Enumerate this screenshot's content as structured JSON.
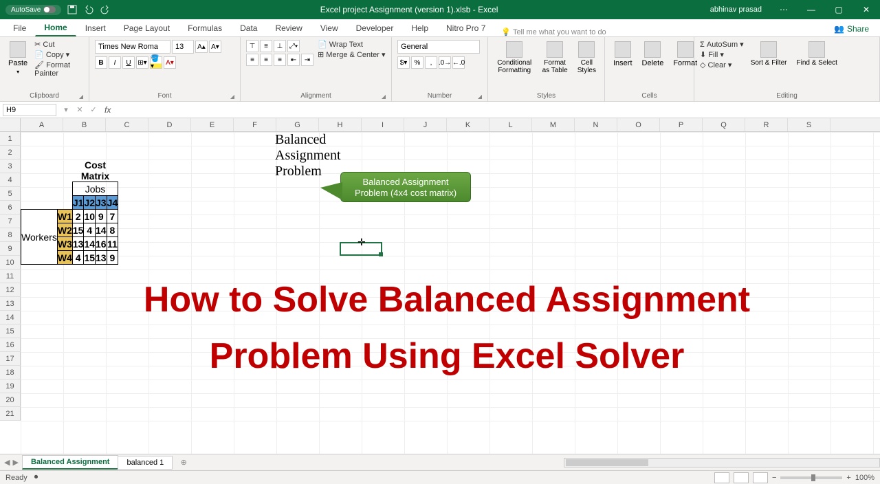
{
  "titlebar": {
    "autosave": "AutoSave",
    "title": "Excel project Assignment (version 1).xlsb - Excel",
    "user": "abhinav prasad"
  },
  "tabs": [
    "File",
    "Home",
    "Insert",
    "Page Layout",
    "Formulas",
    "Data",
    "Review",
    "View",
    "Developer",
    "Help",
    "Nitro Pro 7"
  ],
  "activeTab": "Home",
  "tellme": "Tell me what you want to do",
  "share": "Share",
  "ribbon": {
    "clipboard": {
      "label": "Clipboard",
      "paste": "Paste",
      "cut": "Cut",
      "copy": "Copy",
      "painter": "Format Painter"
    },
    "font": {
      "label": "Font",
      "name": "Times New Roma",
      "size": "13",
      "bold": "B",
      "italic": "I",
      "underline": "U"
    },
    "alignment": {
      "label": "Alignment",
      "wrap": "Wrap Text",
      "merge": "Merge & Center"
    },
    "number": {
      "label": "Number",
      "format": "General"
    },
    "styles": {
      "label": "Styles",
      "cond": "Conditional Formatting",
      "table": "Format as Table",
      "cell": "Cell Styles"
    },
    "cells": {
      "label": "Cells",
      "insert": "Insert",
      "delete": "Delete",
      "format": "Format"
    },
    "editing": {
      "label": "Editing",
      "autosum": "AutoSum",
      "fill": "Fill",
      "clear": "Clear",
      "sort": "Sort & Filter",
      "find": "Find & Select"
    }
  },
  "formulabar": {
    "namebox": "H9",
    "fx": "fx"
  },
  "columns": [
    "A",
    "B",
    "C",
    "D",
    "E",
    "F",
    "G",
    "H",
    "I",
    "J",
    "K",
    "L",
    "M",
    "N",
    "O",
    "P",
    "Q",
    "R",
    "S"
  ],
  "rowCount": 21,
  "sheet": {
    "title": "Balanced Assignment Problem",
    "cost_matrix_label": "Cost Matrix",
    "jobs": "Jobs",
    "workers": "Workers",
    "job_headers": [
      "J1",
      "J2",
      "J3",
      "J4"
    ],
    "worker_headers": [
      "W1",
      "W2",
      "W3",
      "W4"
    ],
    "matrix": [
      [
        2,
        10,
        9,
        7
      ],
      [
        15,
        4,
        14,
        8
      ],
      [
        13,
        14,
        16,
        11
      ],
      [
        4,
        15,
        13,
        9
      ]
    ],
    "callout_line1": "Balanced Assignment",
    "callout_line2": "Problem (4x4 cost matrix)",
    "overlay_line1": "How to Solve Balanced Assignment",
    "overlay_line2": "Problem Using Excel Solver"
  },
  "sheetTabs": {
    "active": "Balanced Assignment",
    "other": "balanced 1"
  },
  "statusbar": {
    "ready": "Ready",
    "zoom": "100%"
  }
}
